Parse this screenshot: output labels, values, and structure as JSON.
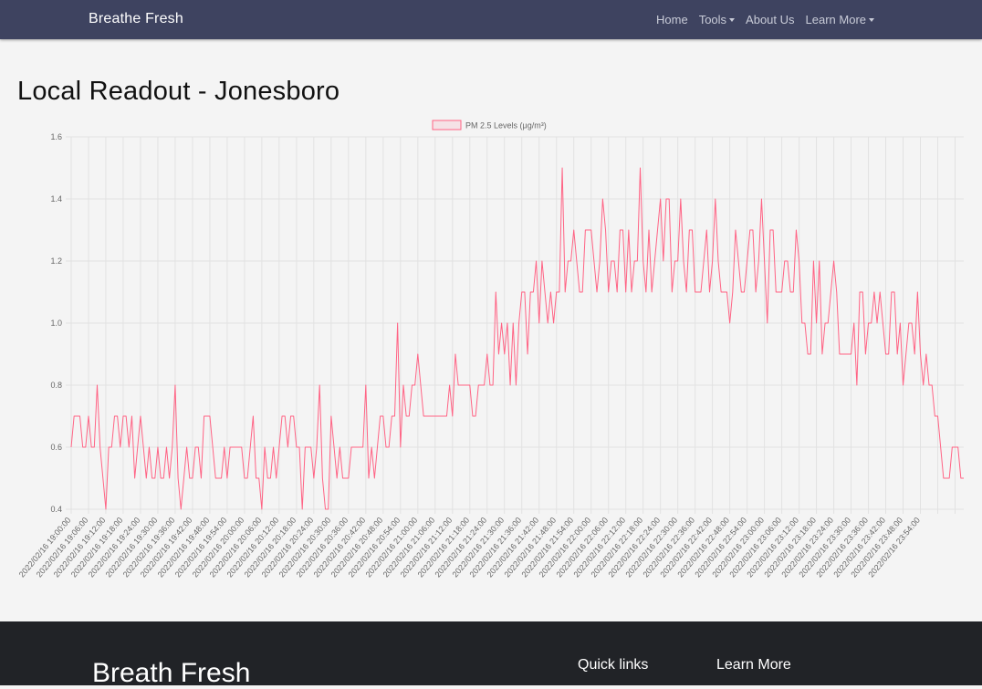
{
  "nav": {
    "brand": "Breathe Fresh",
    "links": [
      "Home",
      "Tools",
      "About Us",
      "Learn More"
    ]
  },
  "page": {
    "title": "Local Readout - Jonesboro"
  },
  "chart_data": {
    "type": "line",
    "title": "",
    "xlabel": "",
    "ylabel": "",
    "ylim": [
      0.4,
      1.6
    ],
    "yticks": [
      0.4,
      0.6,
      0.8,
      1.0,
      1.2,
      1.4,
      1.6
    ],
    "grid": true,
    "legend": "top-center",
    "series": [
      {
        "name": "PM 2.5 Levels (μg/m³)",
        "color": "#ff6384",
        "values": [
          0.6,
          0.7,
          0.7,
          0.7,
          0.6,
          0.6,
          0.7,
          0.6,
          0.6,
          0.8,
          0.6,
          0.5,
          0.4,
          0.6,
          0.6,
          0.7,
          0.7,
          0.6,
          0.7,
          0.7,
          0.6,
          0.7,
          0.5,
          0.6,
          0.7,
          0.6,
          0.5,
          0.6,
          0.5,
          0.5,
          0.6,
          0.5,
          0.5,
          0.6,
          0.5,
          0.6,
          0.8,
          0.5,
          0.4,
          0.5,
          0.6,
          0.5,
          0.5,
          0.6,
          0.6,
          0.5,
          0.7,
          0.7,
          0.7,
          0.6,
          0.5,
          0.5,
          0.5,
          0.6,
          0.5,
          0.6,
          0.6,
          0.6,
          0.6,
          0.6,
          0.5,
          0.5,
          0.6,
          0.7,
          0.5,
          0.5,
          0.4,
          0.6,
          0.5,
          0.5,
          0.6,
          0.5,
          0.6,
          0.7,
          0.7,
          0.6,
          0.7,
          0.7,
          0.6,
          0.6,
          0.4,
          0.6,
          0.6,
          0.6,
          0.5,
          0.6,
          0.8,
          0.5,
          0.4,
          0.4,
          0.7,
          0.6,
          0.5,
          0.6,
          0.5,
          0.5,
          0.5,
          0.6,
          0.6,
          0.6,
          0.6,
          0.6,
          0.8,
          0.5,
          0.6,
          0.5,
          0.6,
          0.7,
          0.7,
          0.6,
          0.6,
          0.7,
          0.7,
          1.0,
          0.6,
          0.8,
          0.7,
          0.7,
          0.8,
          0.8,
          0.9,
          0.8,
          0.7,
          0.7,
          0.7,
          0.7,
          0.7,
          0.7,
          0.7,
          0.7,
          0.7,
          0.8,
          0.7,
          0.9,
          0.8,
          0.8,
          0.8,
          0.8,
          0.8,
          0.7,
          0.7,
          0.8,
          0.8,
          0.8,
          0.9,
          0.8,
          0.8,
          1.1,
          0.9,
          1.0,
          0.9,
          1.0,
          0.8,
          1.0,
          0.8,
          1.0,
          1.1,
          1.1,
          0.9,
          1.1,
          1.1,
          1.2,
          1.0,
          1.2,
          1.1,
          1.0,
          1.1,
          1.0,
          1.1,
          1.1,
          1.5,
          1.1,
          1.2,
          1.2,
          1.3,
          1.2,
          1.1,
          1.1,
          1.3,
          1.3,
          1.3,
          1.2,
          1.1,
          1.2,
          1.4,
          1.3,
          1.1,
          1.2,
          1.2,
          1.1,
          1.3,
          1.3,
          1.1,
          1.3,
          1.1,
          1.2,
          1.2,
          1.5,
          1.2,
          1.1,
          1.3,
          1.1,
          1.2,
          1.3,
          1.4,
          1.2,
          1.4,
          1.4,
          1.1,
          1.2,
          1.2,
          1.4,
          1.2,
          1.1,
          1.3,
          1.3,
          1.1,
          1.1,
          1.1,
          1.2,
          1.3,
          1.1,
          1.2,
          1.4,
          1.2,
          1.1,
          1.1,
          1.1,
          1.0,
          1.1,
          1.3,
          1.2,
          1.1,
          1.1,
          1.2,
          1.3,
          1.3,
          1.1,
          1.2,
          1.4,
          1.2,
          1.0,
          1.3,
          1.3,
          1.1,
          1.1,
          1.1,
          1.2,
          1.2,
          1.1,
          1.1,
          1.3,
          1.2,
          1.0,
          1.0,
          0.9,
          0.9,
          1.2,
          1.0,
          1.2,
          0.9,
          1.0,
          1.0,
          1.1,
          1.2,
          1.1,
          0.9,
          0.9,
          0.9,
          0.9,
          0.9,
          1.0,
          0.8,
          1.1,
          1.1,
          0.9,
          1.0,
          1.0,
          1.1,
          1.0,
          1.1,
          1.0,
          0.9,
          0.9,
          1.1,
          1.1,
          0.9,
          1.0,
          0.8,
          0.9,
          1.0,
          1.0,
          0.9,
          1.1,
          0.9,
          0.8,
          0.9,
          0.8,
          0.8,
          0.7,
          0.7,
          0.6,
          0.5,
          0.5,
          0.5,
          0.6,
          0.6,
          0.6,
          0.5,
          0.5
        ]
      }
    ],
    "x_tick_labels": [
      "2022/02/16 19:00:00",
      "2022/02/16 19:06:00",
      "2022/02/16 19:12:00",
      "2022/02/16 19:18:00",
      "2022/02/16 19:24:00",
      "2022/02/16 19:30:00",
      "2022/02/16 19:36:00",
      "2022/02/16 19:42:00",
      "2022/02/16 19:48:00",
      "2022/02/16 19:54:00",
      "2022/02/16 20:00:00",
      "2022/02/16 20:06:00",
      "2022/02/16 20:12:00",
      "2022/02/16 20:18:00",
      "2022/02/16 20:24:00",
      "2022/02/16 20:30:00",
      "2022/02/16 20:36:00",
      "2022/02/16 20:42:00",
      "2022/02/16 20:48:00",
      "2022/02/16 20:54:00",
      "2022/02/16 21:00:00",
      "2022/02/16 21:06:00",
      "2022/02/16 21:12:00",
      "2022/02/16 21:18:00",
      "2022/02/16 21:24:00",
      "2022/02/16 21:30:00",
      "2022/02/16 21:36:00",
      "2022/02/16 21:42:00",
      "2022/02/16 21:48:00",
      "2022/02/16 21:54:00",
      "2022/02/16 22:00:00",
      "2022/02/16 22:06:00",
      "2022/02/16 22:12:00",
      "2022/02/16 22:18:00",
      "2022/02/16 22:24:00",
      "2022/02/16 22:30:00",
      "2022/02/16 22:36:00",
      "2022/02/16 22:42:00",
      "2022/02/16 22:48:00",
      "2022/02/16 22:54:00",
      "2022/02/16 23:00:00",
      "2022/02/16 23:06:00",
      "2022/02/16 23:12:00",
      "2022/02/16 23:18:00",
      "2022/02/16 23:24:00",
      "2022/02/16 23:30:00",
      "2022/02/16 23:36:00",
      "2022/02/16 23:42:00",
      "2022/02/16 23:48:00",
      "2022/02/16 23:54:00"
    ]
  },
  "footer": {
    "brand": "Breath Fresh",
    "quick_links_heading": "Quick links",
    "learn_more_heading": "Learn More"
  }
}
